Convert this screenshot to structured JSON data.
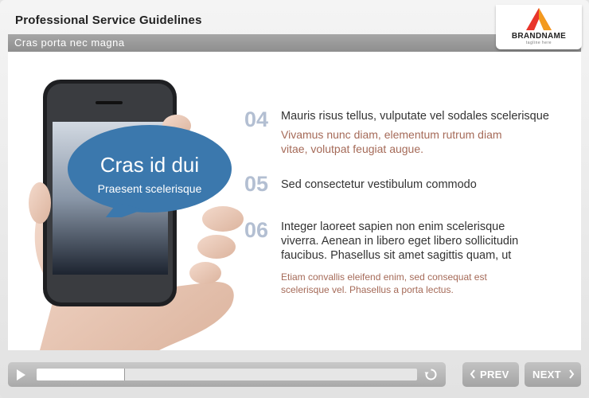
{
  "header": {
    "title": "Professional Service Guidelines",
    "subtitle": "Cras porta nec magna"
  },
  "logo": {
    "name": "BRANDNAME",
    "tagline": "tagline here",
    "icon": "triangle-logo-icon",
    "colors": [
      "#e8352b",
      "#f39a1e"
    ]
  },
  "bubble": {
    "title": "Cras id dui",
    "subtitle": "Praesent scelerisque",
    "color": "#3b78ad"
  },
  "items": [
    {
      "number": "04",
      "heading": "Mauris risus tellus, vulputate vel sodales scelerisque",
      "accent_lines": [
        "Vivamus nunc diam, elementum rutrum diam",
        "vitae, volutpat feugiat augue."
      ]
    },
    {
      "number": "05",
      "heading": "Sed consectetur vestibulum commodo"
    },
    {
      "number": "06",
      "heading_lines": [
        "Integer laoreet sapien non enim scelerisque",
        "viverra. Aenean in libero eget libero sollicitudin",
        "faucibus. Phasellus sit amet sagittis quam, ut"
      ],
      "note_lines": [
        "Etiam convallis eleifend enim, sed consequat est",
        "scelerisque vel. Phasellus a porta lectus."
      ]
    }
  ],
  "player": {
    "progress": 0.23,
    "play_icon": "play-icon",
    "replay_icon": "replay-icon"
  },
  "navigation": {
    "prev_label": "PREV",
    "next_label": "NEXT"
  },
  "colors": {
    "number": "#b3bfd2",
    "accent_text": "#a56a58",
    "header_bar": "#9a9a9a"
  }
}
